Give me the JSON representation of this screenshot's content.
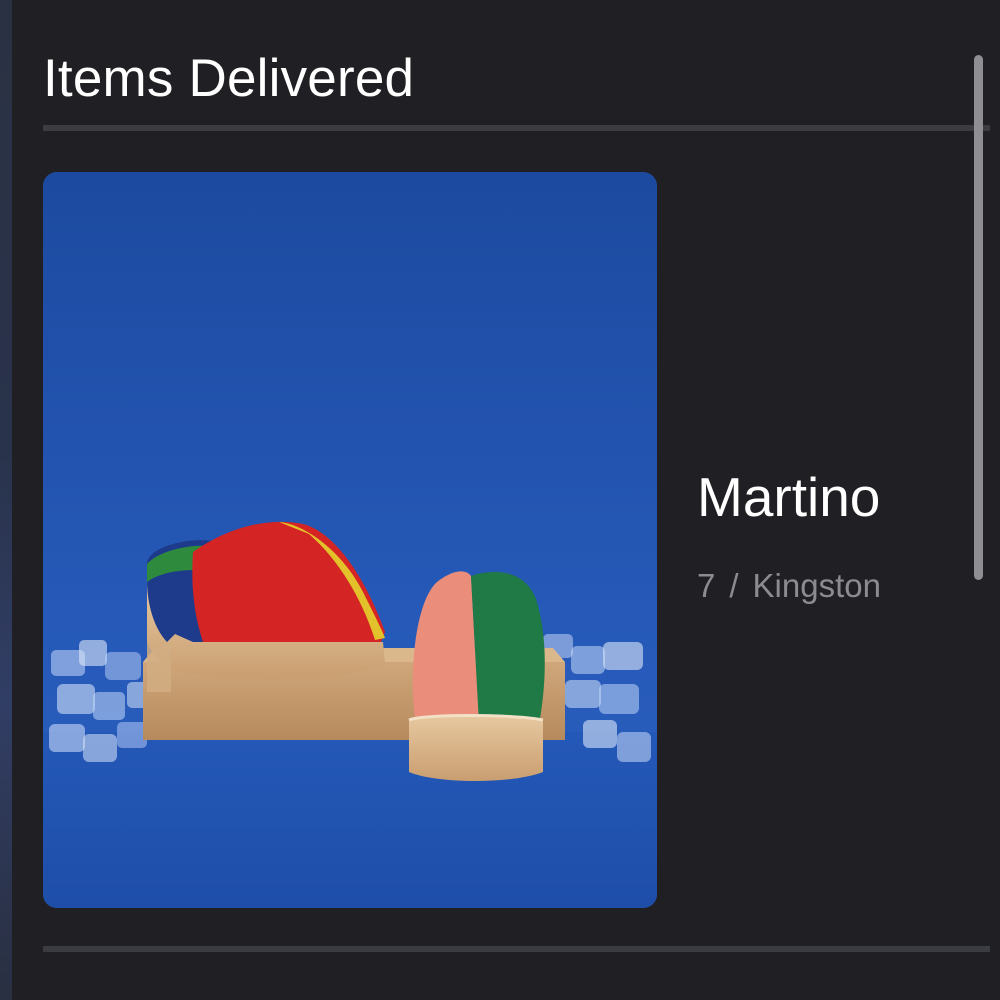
{
  "section": {
    "title": "Items Delivered"
  },
  "item": {
    "name": "Martino",
    "quantity": "7",
    "separator": "/",
    "location": "Kingston",
    "image_icon": "product-photo-clogs"
  },
  "colors": {
    "background": "#202024",
    "divider": "#3b3c41",
    "title_text": "#ffffff",
    "meta_text": "#8c8c90",
    "photo_backdrop": "#2258b5"
  }
}
